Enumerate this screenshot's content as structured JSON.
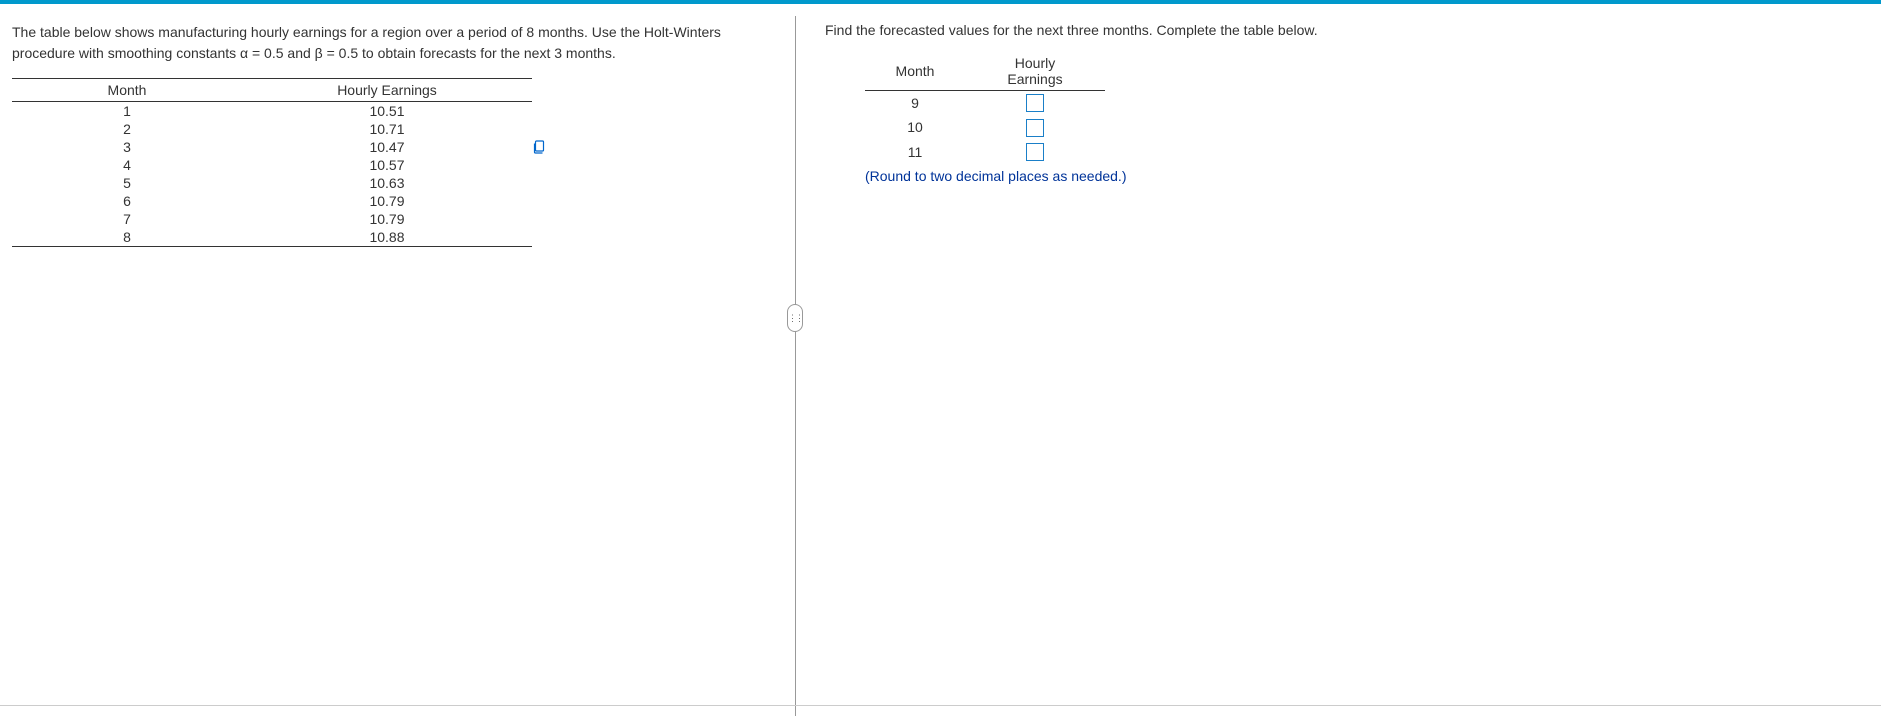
{
  "left": {
    "problem_text": "The table below shows manufacturing hourly earnings for a region over a period of 8 months. Use the Holt-Winters procedure with smoothing constants α = 0.5  and β = 0.5 to obtain forecasts for the next 3 months.",
    "table": {
      "headers": {
        "month": "Month",
        "earnings": "Hourly Earnings"
      },
      "rows": [
        {
          "month": "1",
          "earnings": "10.51"
        },
        {
          "month": "2",
          "earnings": "10.71"
        },
        {
          "month": "3",
          "earnings": "10.47"
        },
        {
          "month": "4",
          "earnings": "10.57"
        },
        {
          "month": "5",
          "earnings": "10.63"
        },
        {
          "month": "6",
          "earnings": "10.79"
        },
        {
          "month": "7",
          "earnings": "10.79"
        },
        {
          "month": "8",
          "earnings": "10.88"
        }
      ]
    }
  },
  "right": {
    "instruction": "Find the forecasted values for the next three months. Complete the table below.",
    "table": {
      "headers": {
        "month": "Month",
        "earnings": "Hourly Earnings"
      },
      "rows": [
        {
          "month": "9"
        },
        {
          "month": "10"
        },
        {
          "month": "11"
        }
      ]
    },
    "hint": "(Round to two decimal places as needed.)"
  }
}
